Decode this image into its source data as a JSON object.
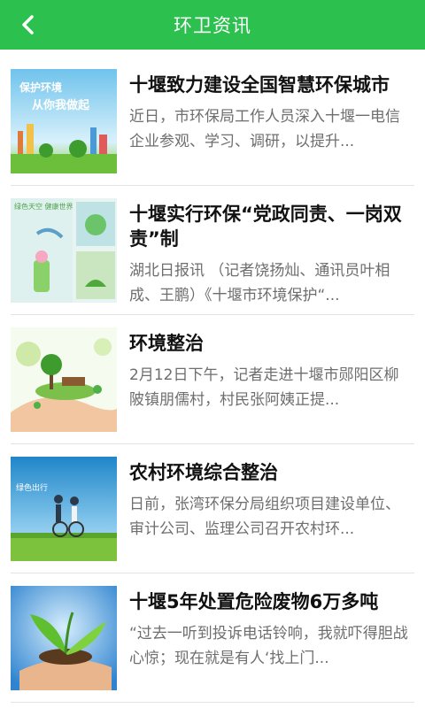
{
  "header": {
    "title": "环卫资讯",
    "back_icon": "chevron-left-icon",
    "color": "#2cc04f"
  },
  "news": [
    {
      "title": "十堰致力建设全国智慧环保城市",
      "summary": "近日，市环保局工作人员深入十堰一电信企业参观、学习、调研，以提升...",
      "image_text": [
        "保护环境",
        "从你我做起"
      ]
    },
    {
      "title": "十堰实行环保“党政同责、一岗双责”制",
      "summary": "湖北日报讯 （记者饶扬灿、通讯员叶相成、王鹏）《十堰市环境保护“...",
      "image_text": [
        "绿色天空 健康世界"
      ]
    },
    {
      "title": "环境整治",
      "summary": "2月12日下午，记者走进十堰市郧阳区柳陂镇朋儒村，村民张阿姨正提...",
      "image_text": []
    },
    {
      "title": "农村环境综合整治",
      "summary": "日前，张湾环保分局组织项目建设单位、审计公司、监理公司召开农村环...",
      "image_text": [
        "绿色出行"
      ]
    },
    {
      "title": "十堰5年处置危险废物6万多吨",
      "summary": "“过去一听到投诉电话铃响，我就吓得胆战心惊；现在就是有人‘找上门...",
      "image_text": []
    }
  ]
}
